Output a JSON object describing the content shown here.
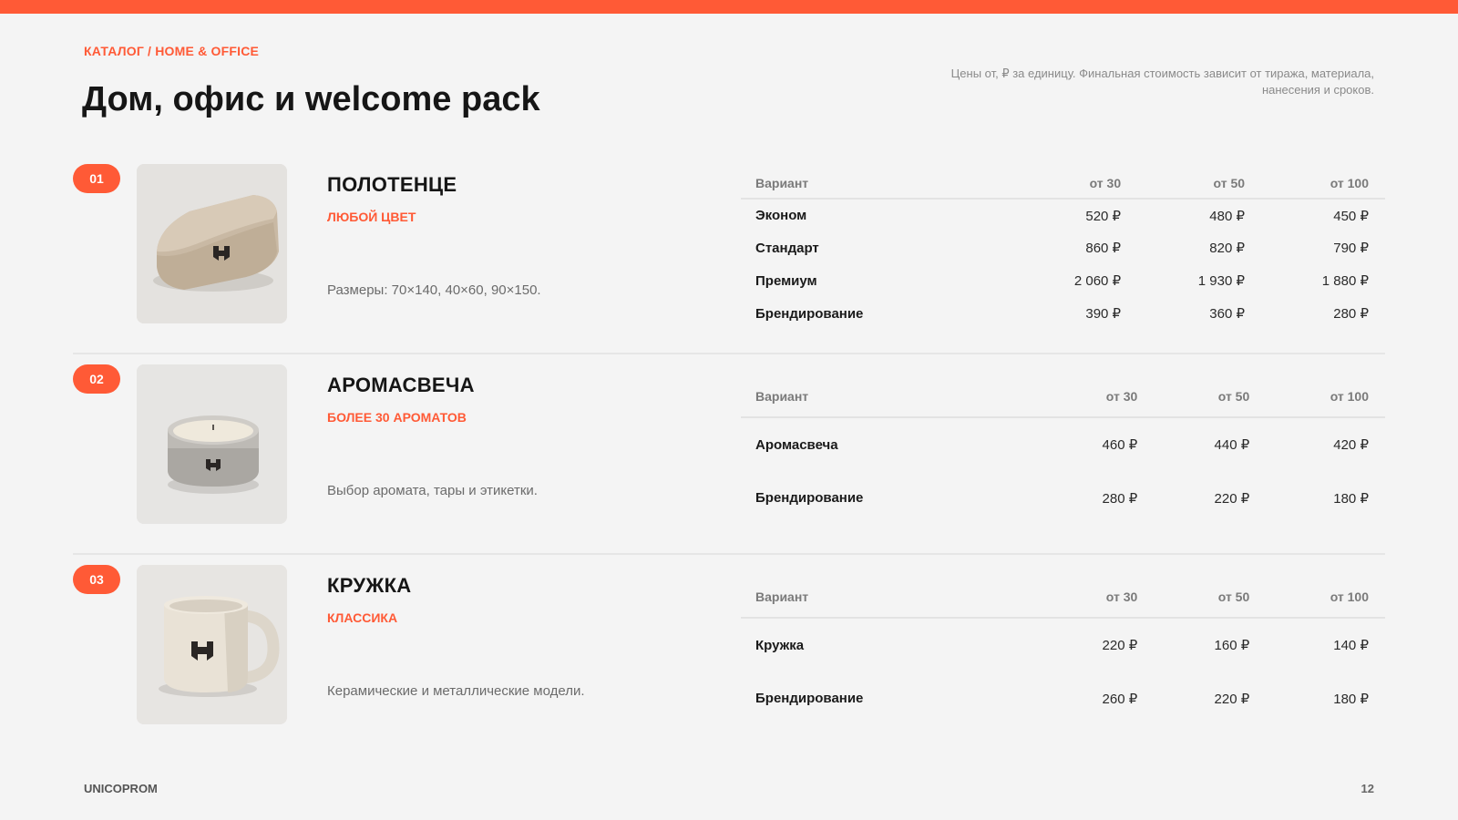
{
  "header": {
    "breadcrumb": "КАТАЛОГ / HOME & OFFICE",
    "title": "Дом, офис и welcome pack",
    "note": "Цены от, ₽ за единицу. Финальная стоимость зависит от тиража, материала, нанесения и сроков."
  },
  "products": [
    {
      "number": "01",
      "name": "ПОЛОТЕНЦЕ",
      "tag": "ЛЮБОЙ ЦВЕТ",
      "description": "Размеры: 70×140, 40×60, 90×150.",
      "image_icon": "folded-towel-photo",
      "table": {
        "headers": [
          "Вариант",
          "от 30",
          "от 50",
          "от 100"
        ],
        "rows": [
          [
            "Эконом",
            "520 ₽",
            "480 ₽",
            "450 ₽"
          ],
          [
            "Стандарт",
            "860 ₽",
            "820 ₽",
            "790 ₽"
          ],
          [
            "Премиум",
            "2 060 ₽",
            "1 930 ₽",
            "1 880 ₽"
          ],
          [
            "Брендирование",
            "390 ₽",
            "360 ₽",
            "280 ₽"
          ]
        ]
      }
    },
    {
      "number": "02",
      "name": "АРОМАСВЕЧА",
      "tag": "БОЛЕЕ 30 АРОМАТОВ",
      "description": "Выбор аромата, тары и этикетки.",
      "image_icon": "tin-candle-photo",
      "table": {
        "headers": [
          "Вариант",
          "от 30",
          "от 50",
          "от 100"
        ],
        "rows": [
          [
            "Аромасвеча",
            "460 ₽",
            "440 ₽",
            "420 ₽"
          ],
          [
            "Брендирование",
            "280 ₽",
            "220 ₽",
            "180 ₽"
          ]
        ]
      }
    },
    {
      "number": "03",
      "name": "КРУЖКА",
      "tag": "КЛАССИКА",
      "description": "Керамические и металлические модели.",
      "image_icon": "ceramic-mug-photo",
      "table": {
        "headers": [
          "Вариант",
          "от 30",
          "от 50",
          "от 100"
        ],
        "rows": [
          [
            "Кружка",
            "220 ₽",
            "160 ₽",
            "140 ₽"
          ],
          [
            "Брендирование",
            "260 ₽",
            "220 ₽",
            "180 ₽"
          ]
        ]
      }
    }
  ],
  "footer": {
    "brand": "UNICOPROM",
    "page_number": "12"
  },
  "colors": {
    "accent": "#ff5a36",
    "background": "#f4f4f4"
  }
}
